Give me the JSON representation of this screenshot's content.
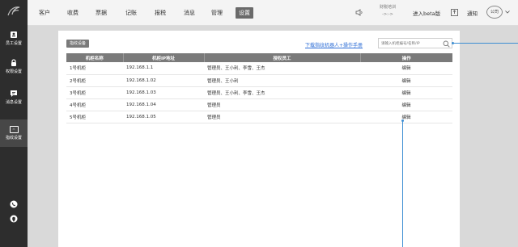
{
  "sidebar": {
    "items": [
      {
        "label": "员工设置",
        "icon": "badge-icon"
      },
      {
        "label": "权限设置",
        "icon": "lock-icon"
      },
      {
        "label": "消息设置",
        "icon": "message-icon"
      },
      {
        "label": "指纹设置",
        "icon": "fingerprint-device-icon",
        "icon_text": "▭"
      }
    ]
  },
  "nav": {
    "items": [
      "客户",
      "收费",
      "票据",
      "记账",
      "报税",
      "消息",
      "管理",
      "设置"
    ],
    "active": "设置"
  },
  "top_right": {
    "clock_line1": "财税培训",
    "clock_line2": "->:->",
    "beta_label": "进入beta版",
    "notify_label": "通知",
    "company_label": "公司"
  },
  "toolbar": {
    "add_button": "指纹设备",
    "download_link": "下载指纹机器人+操作手册",
    "search_placeholder": "请输入机柜编号/名称/IP"
  },
  "table": {
    "headers": [
      "机柜名称",
      "机柜IP地址",
      "授权员工",
      "操作"
    ],
    "rows": [
      {
        "name": "1号机柜",
        "ip": "192.168.1.1",
        "staff": "管理员、王小利、李雪、王杰",
        "action": "编辑"
      },
      {
        "name": "2号机柜",
        "ip": "192.168.1.02",
        "staff": "管理员、王小利",
        "action": "编辑"
      },
      {
        "name": "3号机柜",
        "ip": "192.168.1.03",
        "staff": "管理员、王小利、李雪、王杰",
        "action": "编辑"
      },
      {
        "name": "4号机柜",
        "ip": "192.168.1.04",
        "staff": "管理员",
        "action": "编辑"
      },
      {
        "name": "5号机柜",
        "ip": "192.168.1.05",
        "staff": "管理员",
        "action": "编辑"
      }
    ]
  },
  "colors": {
    "sidebar_bg": "#2d2d2d",
    "accent_link": "#2f6fd6",
    "header_gray": "#7a7a7a",
    "pointer_blue": "#3d8ed3"
  }
}
